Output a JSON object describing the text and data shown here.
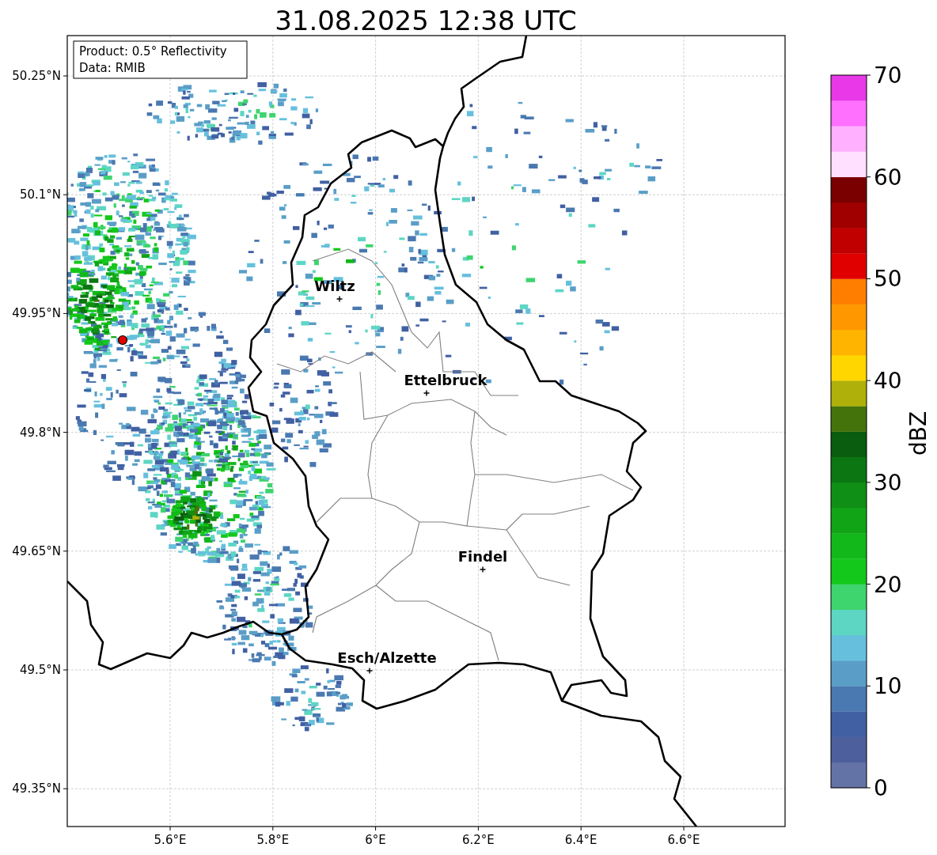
{
  "title": "31.08.2025 12:38 UTC",
  "info_box": [
    "Product: 0.5° Reflectivity",
    "Data: RMIB"
  ],
  "map": {
    "lat_ticks": [
      "50.25°N",
      "50.1°N",
      "49.95°N",
      "49.8°N",
      "49.65°N",
      "49.5°N",
      "49.35°N"
    ],
    "lon_ticks": [
      "5.6°E",
      "5.8°E",
      "6°E",
      "6.2°E",
      "6.4°E",
      "6.6°E"
    ],
    "cities": [
      {
        "name": "Wiltz"
      },
      {
        "name": "Ettelbruck"
      },
      {
        "name": "Findel"
      },
      {
        "name": "Esch/Alzette"
      }
    ]
  },
  "colorbar": {
    "label": "dBZ",
    "ticks": [
      "70",
      "60",
      "50",
      "40",
      "30",
      "20",
      "10",
      "0"
    ],
    "bins": [
      {
        "color": "#6473a6"
      },
      {
        "color": "#4e5f9d"
      },
      {
        "color": "#4160a3"
      },
      {
        "color": "#4a78b0"
      },
      {
        "color": "#5a9ec8"
      },
      {
        "color": "#66c0dd"
      },
      {
        "color": "#5dd6c4"
      },
      {
        "color": "#3ed46e"
      },
      {
        "color": "#13c81a"
      },
      {
        "color": "#12b81a"
      },
      {
        "color": "#10a416"
      },
      {
        "color": "#0f8f15"
      },
      {
        "color": "#0b7612"
      },
      {
        "color": "#0a5c0e"
      },
      {
        "color": "#45730b"
      },
      {
        "color": "#afb00a"
      },
      {
        "color": "#ffd600"
      },
      {
        "color": "#ffb400"
      },
      {
        "color": "#ff9800"
      },
      {
        "color": "#ff7e00"
      },
      {
        "color": "#e00000"
      },
      {
        "color": "#c00000"
      },
      {
        "color": "#a00000"
      },
      {
        "color": "#7a0000"
      },
      {
        "color": "#ffe0ff"
      },
      {
        "color": "#ffb0ff"
      },
      {
        "color": "#ff70ff"
      },
      {
        "color": "#e838e8"
      }
    ]
  }
}
